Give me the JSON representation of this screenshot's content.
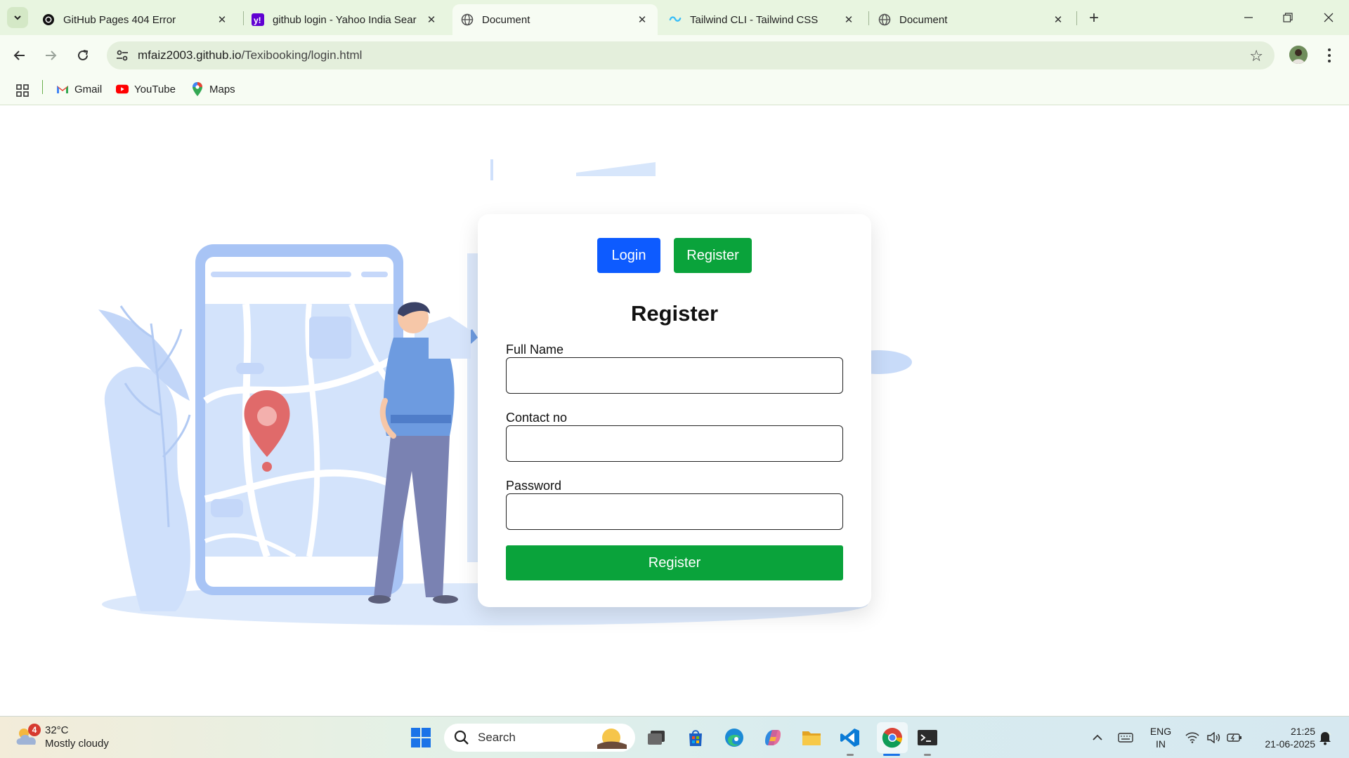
{
  "browser": {
    "tabs": [
      {
        "title": "GitHub Pages 404 Error",
        "favicon": "github-icon",
        "active": false
      },
      {
        "title": "github login - Yahoo India Sear",
        "favicon": "yahoo-icon",
        "active": false
      },
      {
        "title": "Document",
        "favicon": "globe-icon",
        "active": true
      },
      {
        "title": "Tailwind CLI - Tailwind CSS",
        "favicon": "tailwind-icon",
        "active": false
      },
      {
        "title": "Document",
        "favicon": "globe-icon",
        "active": false
      }
    ],
    "url_host": "mfaiz2003.github.io",
    "url_path": "/Texibooking/login.html",
    "bookmarks": [
      {
        "label": "Gmail",
        "icon": "gmail-icon"
      },
      {
        "label": "YouTube",
        "icon": "youtube-icon"
      },
      {
        "label": "Maps",
        "icon": "maps-icon"
      }
    ],
    "colors": {
      "tabstrip": "#e8f5e0",
      "toolbar": "#f7fcf3"
    }
  },
  "page": {
    "toggle": {
      "login_label": "Login",
      "register_label": "Register"
    },
    "form": {
      "title": "Register",
      "fields": [
        {
          "label": "Full Name",
          "value": ""
        },
        {
          "label": "Contact no",
          "value": ""
        },
        {
          "label": "Password",
          "value": ""
        }
      ],
      "submit_label": "Register"
    },
    "colors": {
      "login_button": "#0d5bff",
      "register_button": "#0aa33b"
    }
  },
  "taskbar": {
    "weather": {
      "badge": "4",
      "temp": "32°C",
      "condition": "Mostly cloudy"
    },
    "search_placeholder": "Search",
    "apps": [
      "windows-start-icon",
      "task-view-icon",
      "store-icon",
      "edge-icon",
      "copilot-icon",
      "file-explorer-icon",
      "vscode-icon",
      "chrome-icon",
      "terminal-icon"
    ],
    "tray": {
      "lang_top": "ENG",
      "lang_bottom": "IN",
      "time": "21:25",
      "date": "21-06-2025"
    }
  }
}
